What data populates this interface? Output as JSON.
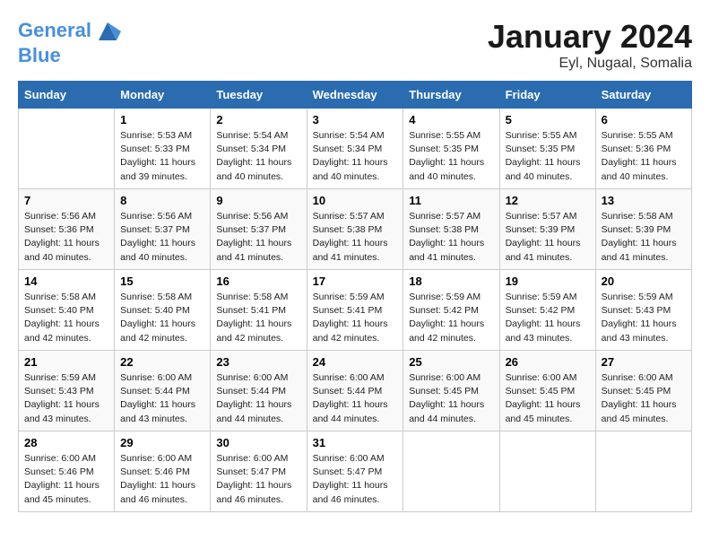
{
  "header": {
    "logo_line1": "General",
    "logo_line2": "Blue",
    "month": "January 2024",
    "location": "Eyl, Nugaal, Somalia"
  },
  "weekdays": [
    "Sunday",
    "Monday",
    "Tuesday",
    "Wednesday",
    "Thursday",
    "Friday",
    "Saturday"
  ],
  "weeks": [
    [
      {
        "day": "",
        "info": ""
      },
      {
        "day": "1",
        "info": "Sunrise: 5:53 AM\nSunset: 5:33 PM\nDaylight: 11 hours\nand 39 minutes."
      },
      {
        "day": "2",
        "info": "Sunrise: 5:54 AM\nSunset: 5:34 PM\nDaylight: 11 hours\nand 40 minutes."
      },
      {
        "day": "3",
        "info": "Sunrise: 5:54 AM\nSunset: 5:34 PM\nDaylight: 11 hours\nand 40 minutes."
      },
      {
        "day": "4",
        "info": "Sunrise: 5:55 AM\nSunset: 5:35 PM\nDaylight: 11 hours\nand 40 minutes."
      },
      {
        "day": "5",
        "info": "Sunrise: 5:55 AM\nSunset: 5:35 PM\nDaylight: 11 hours\nand 40 minutes."
      },
      {
        "day": "6",
        "info": "Sunrise: 5:55 AM\nSunset: 5:36 PM\nDaylight: 11 hours\nand 40 minutes."
      }
    ],
    [
      {
        "day": "7",
        "info": "Sunrise: 5:56 AM\nSunset: 5:36 PM\nDaylight: 11 hours\nand 40 minutes."
      },
      {
        "day": "8",
        "info": "Sunrise: 5:56 AM\nSunset: 5:37 PM\nDaylight: 11 hours\nand 40 minutes."
      },
      {
        "day": "9",
        "info": "Sunrise: 5:56 AM\nSunset: 5:37 PM\nDaylight: 11 hours\nand 41 minutes."
      },
      {
        "day": "10",
        "info": "Sunrise: 5:57 AM\nSunset: 5:38 PM\nDaylight: 11 hours\nand 41 minutes."
      },
      {
        "day": "11",
        "info": "Sunrise: 5:57 AM\nSunset: 5:38 PM\nDaylight: 11 hours\nand 41 minutes."
      },
      {
        "day": "12",
        "info": "Sunrise: 5:57 AM\nSunset: 5:39 PM\nDaylight: 11 hours\nand 41 minutes."
      },
      {
        "day": "13",
        "info": "Sunrise: 5:58 AM\nSunset: 5:39 PM\nDaylight: 11 hours\nand 41 minutes."
      }
    ],
    [
      {
        "day": "14",
        "info": "Sunrise: 5:58 AM\nSunset: 5:40 PM\nDaylight: 11 hours\nand 42 minutes."
      },
      {
        "day": "15",
        "info": "Sunrise: 5:58 AM\nSunset: 5:40 PM\nDaylight: 11 hours\nand 42 minutes."
      },
      {
        "day": "16",
        "info": "Sunrise: 5:58 AM\nSunset: 5:41 PM\nDaylight: 11 hours\nand 42 minutes."
      },
      {
        "day": "17",
        "info": "Sunrise: 5:59 AM\nSunset: 5:41 PM\nDaylight: 11 hours\nand 42 minutes."
      },
      {
        "day": "18",
        "info": "Sunrise: 5:59 AM\nSunset: 5:42 PM\nDaylight: 11 hours\nand 42 minutes."
      },
      {
        "day": "19",
        "info": "Sunrise: 5:59 AM\nSunset: 5:42 PM\nDaylight: 11 hours\nand 43 minutes."
      },
      {
        "day": "20",
        "info": "Sunrise: 5:59 AM\nSunset: 5:43 PM\nDaylight: 11 hours\nand 43 minutes."
      }
    ],
    [
      {
        "day": "21",
        "info": "Sunrise: 5:59 AM\nSunset: 5:43 PM\nDaylight: 11 hours\nand 43 minutes."
      },
      {
        "day": "22",
        "info": "Sunrise: 6:00 AM\nSunset: 5:44 PM\nDaylight: 11 hours\nand 43 minutes."
      },
      {
        "day": "23",
        "info": "Sunrise: 6:00 AM\nSunset: 5:44 PM\nDaylight: 11 hours\nand 44 minutes."
      },
      {
        "day": "24",
        "info": "Sunrise: 6:00 AM\nSunset: 5:44 PM\nDaylight: 11 hours\nand 44 minutes."
      },
      {
        "day": "25",
        "info": "Sunrise: 6:00 AM\nSunset: 5:45 PM\nDaylight: 11 hours\nand 44 minutes."
      },
      {
        "day": "26",
        "info": "Sunrise: 6:00 AM\nSunset: 5:45 PM\nDaylight: 11 hours\nand 45 minutes."
      },
      {
        "day": "27",
        "info": "Sunrise: 6:00 AM\nSunset: 5:45 PM\nDaylight: 11 hours\nand 45 minutes."
      }
    ],
    [
      {
        "day": "28",
        "info": "Sunrise: 6:00 AM\nSunset: 5:46 PM\nDaylight: 11 hours\nand 45 minutes."
      },
      {
        "day": "29",
        "info": "Sunrise: 6:00 AM\nSunset: 5:46 PM\nDaylight: 11 hours\nand 46 minutes."
      },
      {
        "day": "30",
        "info": "Sunrise: 6:00 AM\nSunset: 5:47 PM\nDaylight: 11 hours\nand 46 minutes."
      },
      {
        "day": "31",
        "info": "Sunrise: 6:00 AM\nSunset: 5:47 PM\nDaylight: 11 hours\nand 46 minutes."
      },
      {
        "day": "",
        "info": ""
      },
      {
        "day": "",
        "info": ""
      },
      {
        "day": "",
        "info": ""
      }
    ]
  ]
}
